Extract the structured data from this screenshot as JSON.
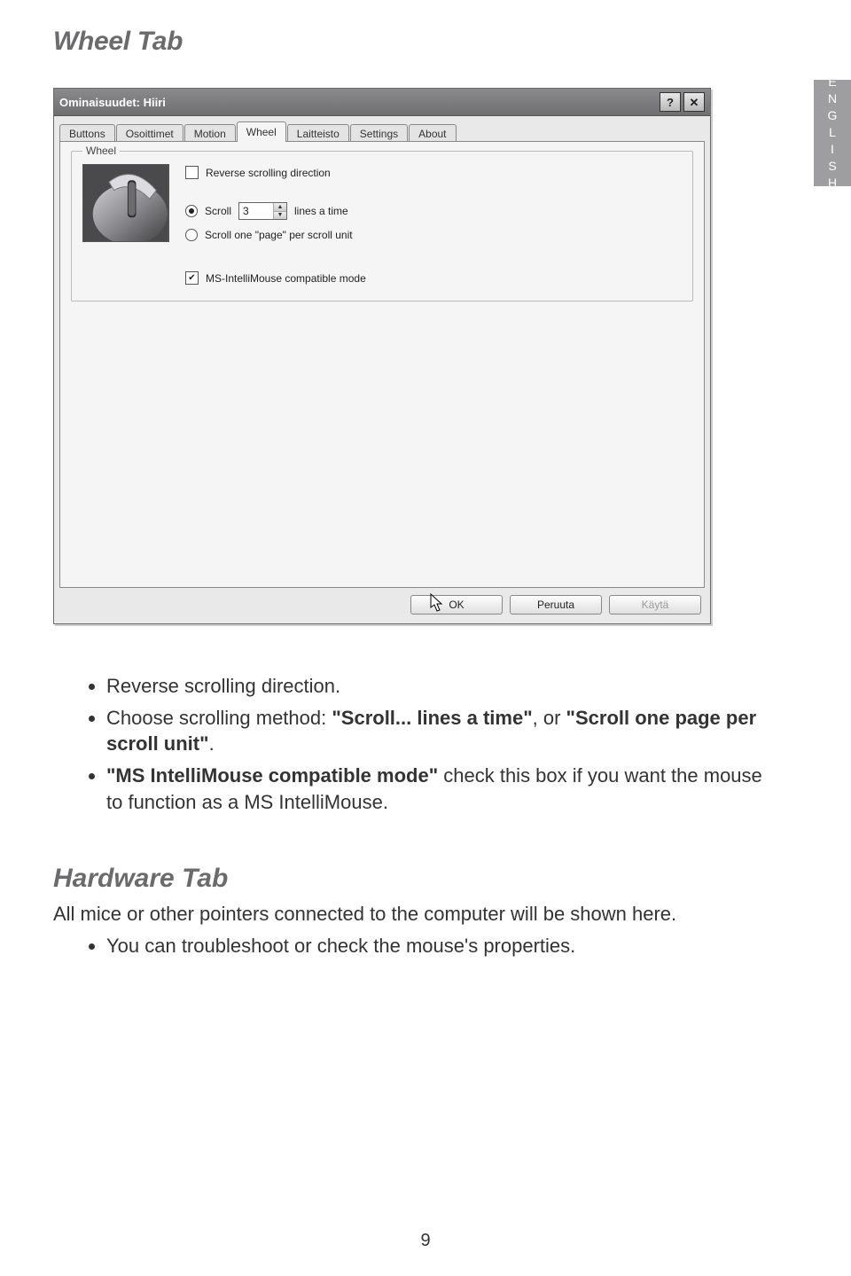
{
  "lang_tab": "ENGLISH",
  "heading_wheel": "Wheel Tab",
  "heading_hardware": "Hardware Tab",
  "dialog": {
    "title": "Ominaisuudet: Hiiri",
    "tabs": [
      "Buttons",
      "Osoittimet",
      "Motion",
      "Wheel",
      "Laitteisto",
      "Settings",
      "About"
    ],
    "active_tab_index": 3,
    "group_legend": "Wheel",
    "reverse_label": "Reverse scrolling direction",
    "scroll_label_pre": "Scroll",
    "scroll_value": "3",
    "scroll_label_post": "lines a time",
    "scroll_page_label": "Scroll one \"page\" per scroll unit",
    "intelli_label": "MS-IntelliMouse compatible mode",
    "btn_ok": "OK",
    "btn_cancel": "Peruuta",
    "btn_apply": "Käytä"
  },
  "bullets_wheel": {
    "b1": "Reverse scrolling direction.",
    "b2_pre": "Choose scrolling method: ",
    "b2_q1": "\"Scroll... lines a time\"",
    "b2_mid": ", or ",
    "b2_q2": "\"Scroll one page per scroll unit\"",
    "b2_end": ".",
    "b3_pre": "\"MS IntelliMouse compatible mode\"",
    "b3_rest": " check this box if you want the mouse to function as a MS IntelliMouse."
  },
  "hardware_para": "All mice or other pointers connected to the computer will be shown here.",
  "hardware_bullet": "You can troubleshoot or check the mouse's properties.",
  "page_number": "9"
}
